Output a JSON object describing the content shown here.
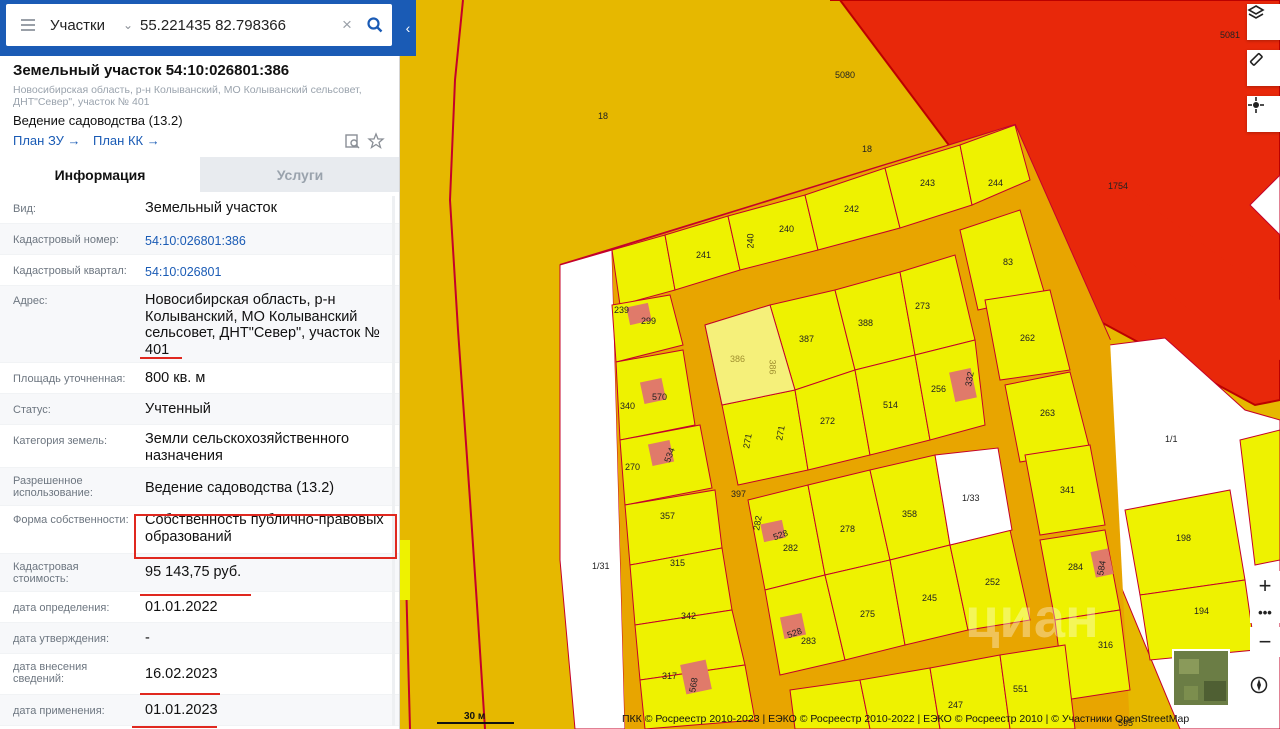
{
  "search": {
    "type": "Участки",
    "value": "55.221435 82.798366"
  },
  "parcel": {
    "title": "Земельный участок 54:10:026801:386",
    "address": "Новосибирская область, р-н Колыванский, МО Колыванский сельсовет, ДНТ\"Север\", участок № 401",
    "use": "Ведение садоводства (13.2)",
    "plan_zu": "План ЗУ →",
    "plan_kk": "План КК →"
  },
  "tabs": [
    {
      "label": "Информация",
      "active": true
    },
    {
      "label": "Услуги",
      "active": false
    }
  ],
  "info": [
    {
      "label": "Вид:",
      "value": "Земельный участок"
    },
    {
      "label": "Кадастровый номер:",
      "value": "54:10:026801:386",
      "link": true
    },
    {
      "label": "Кадастровый квартал:",
      "value": "54:10:026801",
      "link": true
    },
    {
      "label": "Адрес:",
      "value": "Новосибирская область, р-н Колыванский, МО Колыванский сельсовет, ДНТ\"Север\", участок № 401"
    },
    {
      "label": "Площадь уточненная:",
      "value": "800 кв. м"
    },
    {
      "label": "Статус:",
      "value": "Учтенный"
    },
    {
      "label": "Категория земель:",
      "value": "Земли сельскохозяйственного назначения"
    },
    {
      "label": "Разрешенное использование:",
      "value": "Ведение садоводства (13.2)"
    },
    {
      "label": "Форма собственности:",
      "value": "Собственность публично-правовых образований"
    },
    {
      "label": "Кадастровая стоимость:",
      "value": "95 143,75 руб."
    },
    {
      "label": "дата определения:",
      "value": "01.01.2022"
    },
    {
      "label": "дата утверждения:",
      "value": "-"
    },
    {
      "label": "дата внесения сведений:",
      "value": "16.02.2023"
    },
    {
      "label": "дата применения:",
      "value": "01.01.2023"
    }
  ],
  "map": {
    "scale": "30 м",
    "attribution": "ПКК © Росреестр 2010-2023 | ЕЭКО © Росреестр 2010-2022 | ЕЭКО © Росреестр 2010 | © Участники OpenStreetMap",
    "watermark": "циан",
    "labels": [
      "5081",
      "5080",
      "18",
      "18",
      "1754",
      "243",
      "244",
      "242",
      "240",
      "240",
      "241",
      "239",
      "299",
      "83",
      "273",
      "388",
      "387",
      "386",
      "386",
      "262",
      "332",
      "256",
      "514",
      "272",
      "271",
      "271",
      "263",
      "340",
      "570",
      "270",
      "534",
      "397",
      "1/1",
      "341",
      "1/33",
      "357",
      "358",
      "278",
      "282",
      "528",
      "282",
      "198",
      "1/31",
      "315",
      "252",
      "584",
      "284",
      "342",
      "245",
      "275",
      "528",
      "283",
      "194",
      "316",
      "317",
      "568",
      "247",
      "551",
      "595"
    ]
  },
  "colors": {
    "accent": "#1a5bb5",
    "parcel_fill": "#eef200",
    "zone": "#e6b800",
    "road": "#e8a500",
    "danger": "#e8280a",
    "highlight": "#e0281f"
  }
}
